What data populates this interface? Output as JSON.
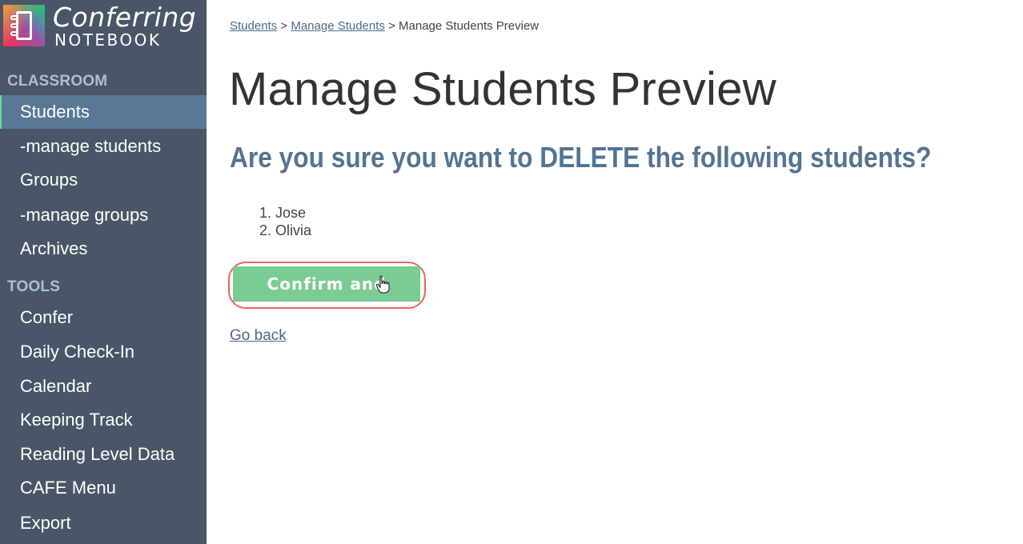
{
  "app": {
    "logo_line1": "Conferring",
    "logo_line2": "NOTEBOOK"
  },
  "sidebar": {
    "sections": [
      {
        "label": "CLASSROOM",
        "items": [
          {
            "label": "Students",
            "active": true
          },
          {
            "label": "-manage students"
          },
          {
            "label": "Groups"
          },
          {
            "label": "-manage groups"
          },
          {
            "label": "Archives"
          }
        ]
      },
      {
        "label": "TOOLS",
        "items": [
          {
            "label": "Confer"
          },
          {
            "label": "Daily Check-In"
          },
          {
            "label": "Calendar"
          },
          {
            "label": "Keeping Track"
          },
          {
            "label": "Reading Level Data"
          },
          {
            "label": "CAFE Menu"
          },
          {
            "label": "Export"
          }
        ]
      }
    ]
  },
  "breadcrumb": {
    "items": [
      "Students",
      "Manage Students",
      "Manage Students Preview"
    ],
    "separator": ">"
  },
  "main": {
    "title": "Manage Students Preview",
    "question": "Are you sure you want to DELETE the following students?",
    "students": [
      "1. Jose",
      "2. Olivia"
    ],
    "confirm_label": "Confirm and Delete",
    "go_back_label": "Go back"
  },
  "colors": {
    "sidebar_bg": "#4a5567",
    "active_item_bg": "#5a7896",
    "section_label": "#a8c0d8",
    "question_text": "#537492",
    "confirm_button": "#7acc92",
    "highlight_ring": "#e8655a",
    "link": "#4a6a88"
  }
}
